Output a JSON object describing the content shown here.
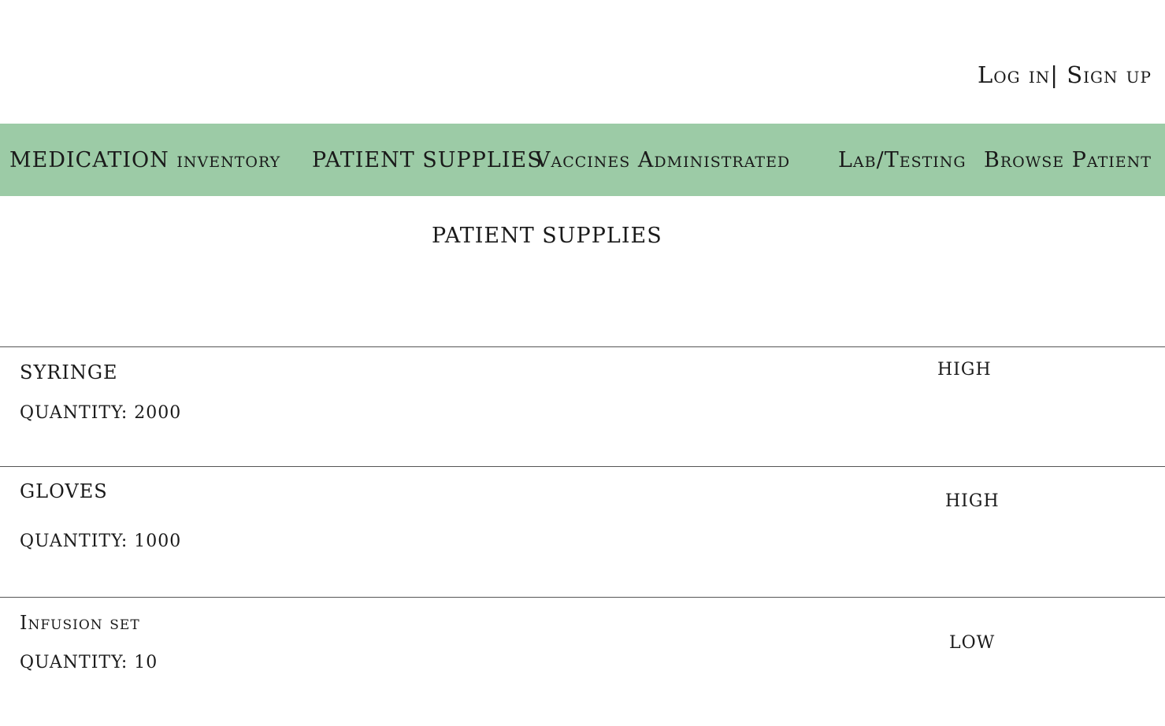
{
  "auth": {
    "login": "Log in",
    "separator": "|",
    "signup": "Sign up"
  },
  "nav": {
    "background": "#9ccba6",
    "items": [
      "MEDICATION inventory",
      "PATIENT SUPPLIES",
      "Vaccines Administrated",
      "Lab/Testing",
      "Browse Patient"
    ]
  },
  "page": {
    "title": "PATIENT SUPPLIES"
  },
  "supplies": [
    {
      "name": "SYRINGE",
      "quantity": "QUANTITY: 2000",
      "level": "HIGH"
    },
    {
      "name": "GLOVES",
      "quantity": "QUANTITY: 1000",
      "level": "HIGH"
    },
    {
      "name": "Infusion set",
      "quantity": "QUANTITY: 10",
      "level": "LOW"
    }
  ]
}
